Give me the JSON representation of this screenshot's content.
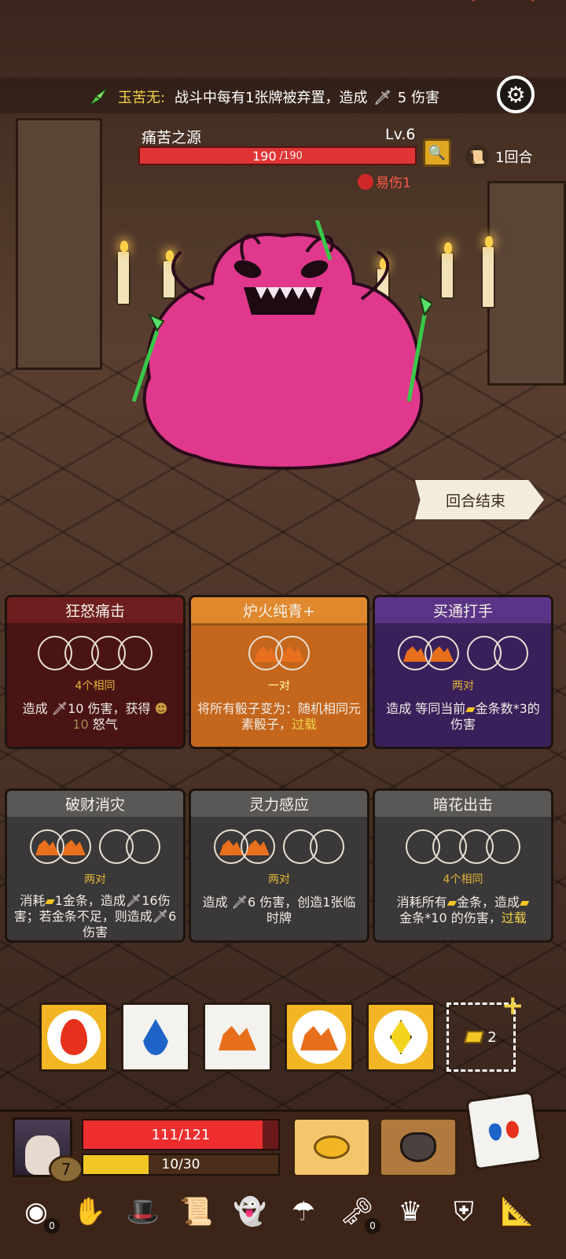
{
  "relic_tip": {
    "name": "玉苦无:",
    "desc_before": "战斗中每有1张牌被弃置，造成",
    "desc_after": "5 伤害"
  },
  "enemy": {
    "name": "痛苦之源",
    "level": "Lv.6",
    "hp": "190",
    "hp_max": "/190",
    "status": "易伤1"
  },
  "round": {
    "label": "1回合"
  },
  "end_turn": {
    "label": "回合结束"
  },
  "cards": [
    {
      "title": "狂怒痛击",
      "req": "4个相同",
      "desc_a": "造成 ",
      "desc_b": "10 伤害，获得 ",
      "desc_hl": "10",
      "desc_c": " 怒气"
    },
    {
      "title": "炉火纯青+",
      "req": "一对",
      "desc_a": "将所有骰子变为：随机相同元素骰子，",
      "desc_hl": "过载"
    },
    {
      "title": "买通打手",
      "req": "两对",
      "desc_a": "造成 等同当前",
      "desc_b": "金条数*3的伤害"
    },
    {
      "title": "破财消灾",
      "req": "两对",
      "desc_a": "消耗",
      "desc_b": "1金条，造成",
      "desc_c": "16伤害；若金条不足，则造成",
      "desc_d": "6 伤害"
    },
    {
      "title": "灵力感应",
      "req": "两对",
      "desc_a": "造成 ",
      "desc_b": "6 伤害，创造1张临时牌"
    },
    {
      "title": "暗花出击",
      "req": "4个相同",
      "desc_a": "消耗所有",
      "desc_b": "金条，造成",
      "desc_c": "金条*10 的伤害，",
      "desc_hl": "过载"
    }
  ],
  "dice": [
    {
      "face": "fire",
      "style": "gold"
    },
    {
      "face": "water",
      "style": "white"
    },
    {
      "face": "earth",
      "style": "white"
    },
    {
      "face": "earth",
      "style": "gold"
    },
    {
      "face": "diamond",
      "style": "gold"
    }
  ],
  "gold": {
    "count": "2"
  },
  "player": {
    "hp_text": "111/121",
    "hp_value": 111,
    "hp_max": 121,
    "shield_text": "10/30",
    "shield_value": 10,
    "shield_max": 30,
    "level": "7"
  },
  "relic_bar": [
    {
      "icon": "button-relic-icon",
      "count": "0"
    },
    {
      "icon": "hand-relic-icon"
    },
    {
      "icon": "feather-hat-relic-icon"
    },
    {
      "icon": "scroll-relic-icon"
    },
    {
      "icon": "ghost-relic-icon"
    },
    {
      "icon": "umbrella-relic-icon"
    },
    {
      "icon": "keys-relic-icon",
      "count": "0"
    },
    {
      "icon": "crown-relic-icon"
    },
    {
      "icon": "armor-relic-icon"
    },
    {
      "icon": "ruler-relic-icon"
    }
  ],
  "colors": {
    "enemy_hp": "#e03535",
    "player_hp": "#ee2e2e",
    "gold": "#f2c624",
    "monster": "#e0388c"
  }
}
